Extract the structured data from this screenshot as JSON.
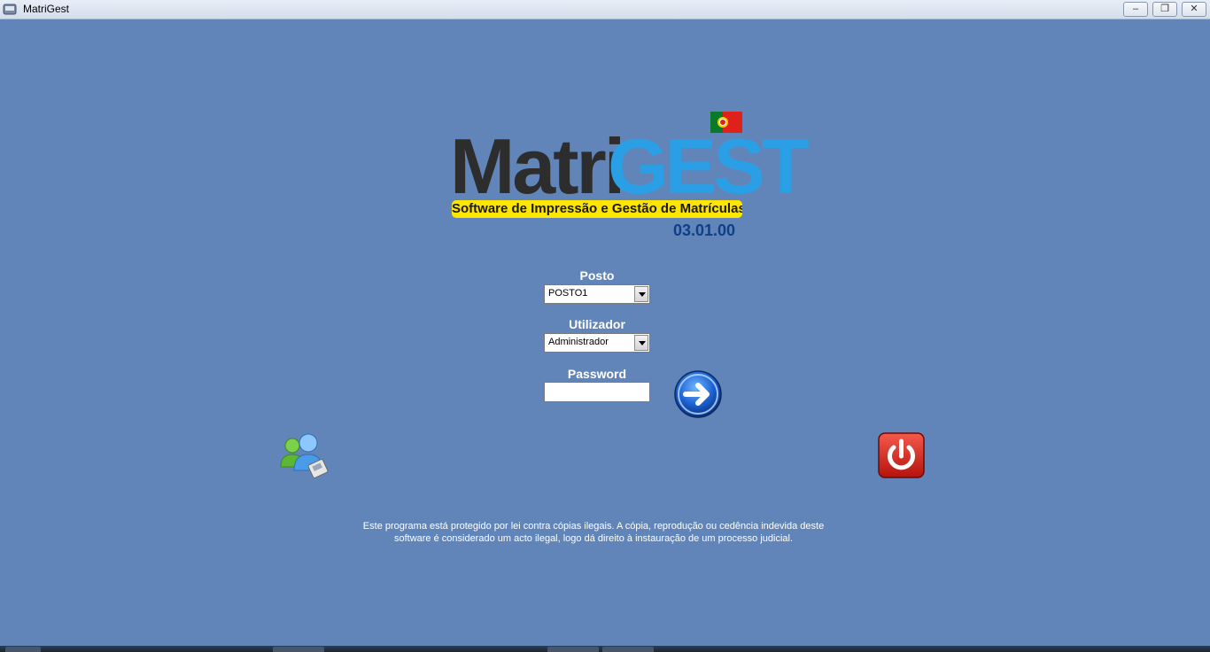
{
  "window": {
    "title": "MatriGest",
    "min_label": "–",
    "max_label": "❐",
    "close_label": "✕"
  },
  "logo": {
    "part1": "Matri",
    "part2": "GEST",
    "tagline": "Software de Impressão e Gestão de Matrículas",
    "version": "03.01.00"
  },
  "form": {
    "posto_label": "Posto",
    "posto_value": "POSTO1",
    "utilizador_label": "Utilizador",
    "utilizador_value": "Administrador",
    "password_label": "Password",
    "password_value": ""
  },
  "footer": {
    "legal_line1": "Este programa está protegido por lei contra cópias ilegais. A cópia, reprodução ou cedência indevida deste",
    "legal_line2": "software é considerado um acto ilegal, logo dá direito à instauração de um processo judicial."
  },
  "colors": {
    "background": "#6285b9",
    "logo_dark": "#2d2d2d",
    "logo_blue": "#2a9fe6",
    "banner_yellow": "#ffe600",
    "version_blue": "#0f3f86"
  },
  "icons": {
    "go": "arrow-right-icon",
    "users": "users-icon",
    "power": "power-icon",
    "flag": "portugal-flag-icon"
  }
}
